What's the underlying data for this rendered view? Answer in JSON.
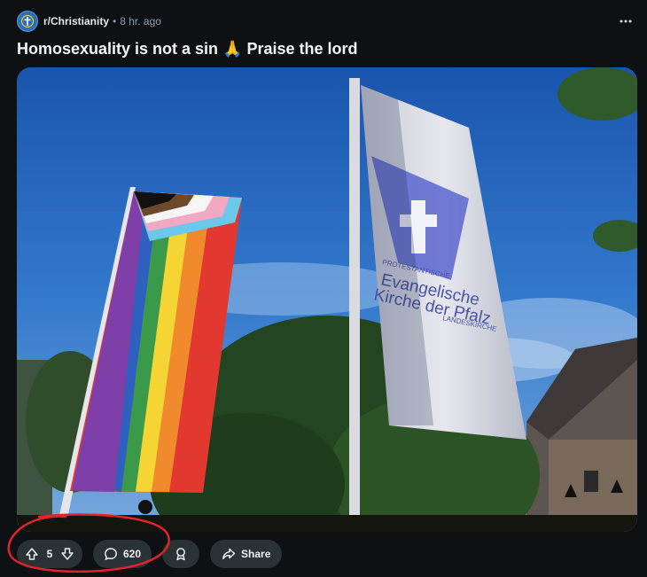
{
  "post": {
    "subreddit": "r/Christianity",
    "separator": "•",
    "time_ago": "8 hr. ago",
    "title": "Homosexuality is not a sin 🙏 Praise the lord"
  },
  "image": {
    "flag_text_line1": "PROTESTANTISCHE",
    "flag_text_line2": "Evangelische",
    "flag_text_line3": "Kirche der Pfalz",
    "flag_text_line4": "LANDESKIRCHE"
  },
  "actions": {
    "vote_count": "5",
    "comment_count": "620",
    "share_label": "Share"
  },
  "colors": {
    "background": "#0e1113",
    "pill": "#2a3236",
    "annotation": "#e0242a"
  }
}
